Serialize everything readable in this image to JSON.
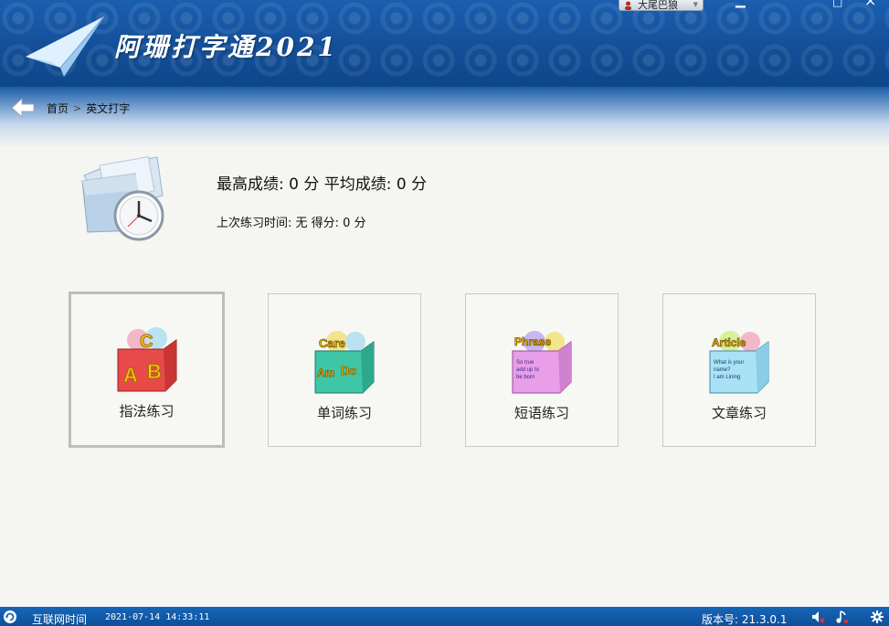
{
  "app": {
    "title": "阿珊打字通2021"
  },
  "user": {
    "name": "大尾巴狼"
  },
  "window_controls": {
    "minimize": "▁",
    "maximize": "□",
    "close": "×"
  },
  "breadcrumb": {
    "home": "首页",
    "separator": ">",
    "current": "英文打字"
  },
  "scores": {
    "best_line": "最高成绩: 0 分  平均成绩: 0 分",
    "last_line": "上次练习时间: 无  得分: 0 分"
  },
  "cards": [
    {
      "label": "指法练习",
      "icon": "abc-box-icon",
      "color": "#e84a4a"
    },
    {
      "label": "单词练习",
      "icon": "word-box-icon",
      "color": "#3fc6a6"
    },
    {
      "label": "短语练习",
      "icon": "phrase-box-icon",
      "color": "#e89ee8"
    },
    {
      "label": "文章练习",
      "icon": "article-box-icon",
      "color": "#8fd8f0"
    }
  ],
  "status_bar": {
    "network_time": "互联网时间",
    "datetime": "2021-07-14 14:33:11",
    "version": "版本号: 21.3.0.1"
  },
  "colors": {
    "header_blue": "#1a5fb0",
    "status_blue": "#1766b8",
    "page_bg": "#f5f5f2"
  }
}
